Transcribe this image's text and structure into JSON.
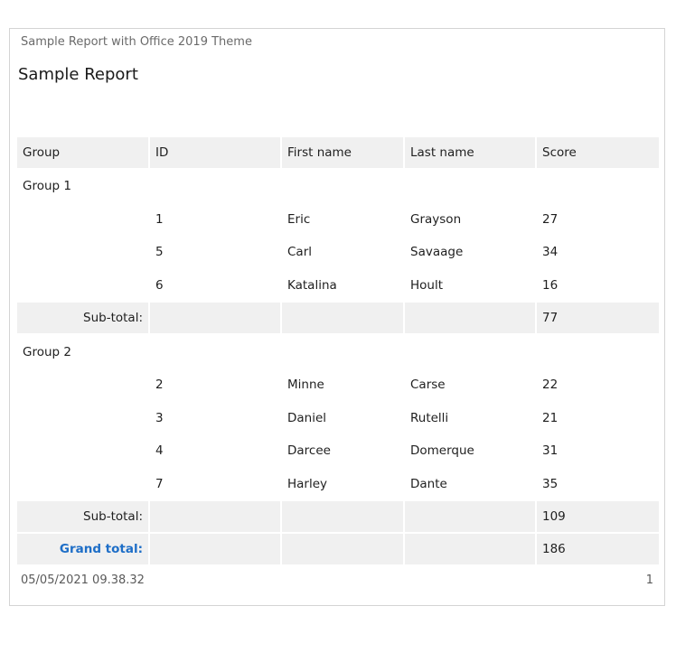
{
  "report": {
    "caption": "Sample Report with Office 2019 Theme",
    "title": "Sample Report",
    "columns": [
      "Group",
      "ID",
      "First name",
      "Last name",
      "Score"
    ],
    "groups": [
      {
        "label": "Group 1",
        "rows": [
          {
            "id": "1",
            "first": "Eric",
            "last": "Grayson",
            "score": "27"
          },
          {
            "id": "5",
            "first": "Carl",
            "last": "Savaage",
            "score": "34"
          },
          {
            "id": "6",
            "first": "Katalina",
            "last": "Hoult",
            "score": "16"
          }
        ],
        "subtotal_label": "Sub-total:",
        "subtotal": "77"
      },
      {
        "label": "Group 2",
        "rows": [
          {
            "id": "2",
            "first": "Minne",
            "last": "Carse",
            "score": "22"
          },
          {
            "id": "3",
            "first": "Daniel",
            "last": "Rutelli",
            "score": "21"
          },
          {
            "id": "4",
            "first": "Darcee",
            "last": "Domerque",
            "score": "31"
          },
          {
            "id": "7",
            "first": "Harley",
            "last": "Dante",
            "score": "35"
          }
        ],
        "subtotal_label": "Sub-total:",
        "subtotal": "109"
      }
    ],
    "grand_total_label": "Grand total:",
    "grand_total": "186",
    "footer_date": "05/05/2021 09.38.32",
    "footer_page": "1"
  },
  "colors": {
    "header_bg": "#f0f0f0",
    "grand_total_accent": "#1e6ec7",
    "border": "#d4d4d4"
  }
}
